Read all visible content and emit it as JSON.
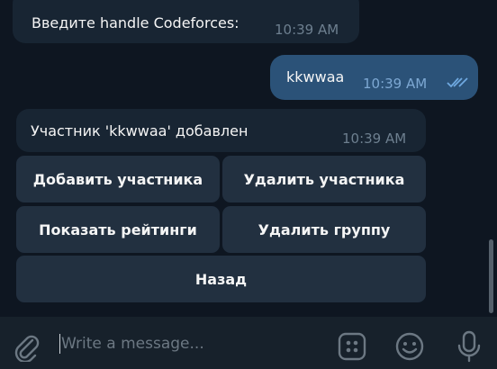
{
  "messages": {
    "prompt": {
      "text": "Введите handle Codeforces:",
      "time": "10:39 AM"
    },
    "reply": {
      "text": "kkwwaa",
      "time": "10:39 AM"
    },
    "confirm": {
      "text": "Участник 'kkwwaa' добавлен",
      "time": "10:39 AM"
    }
  },
  "keyboard": {
    "add_member": "Добавить участника",
    "remove_member": "Удалить участника",
    "show_ratings": "Показать рейтинги",
    "delete_group": "Удалить группу",
    "back": "Назад"
  },
  "composer": {
    "placeholder": "Write a message..."
  },
  "colors": {
    "background": "#0e1621",
    "incoming_bubble": "#182533",
    "outgoing_bubble": "#2b5278",
    "keyboard_button": "#223040",
    "composer": "#17212b"
  },
  "icons": [
    "paperclip-icon",
    "double-check-icon",
    "command-menu-icon",
    "emoji-icon",
    "microphone-icon"
  ]
}
